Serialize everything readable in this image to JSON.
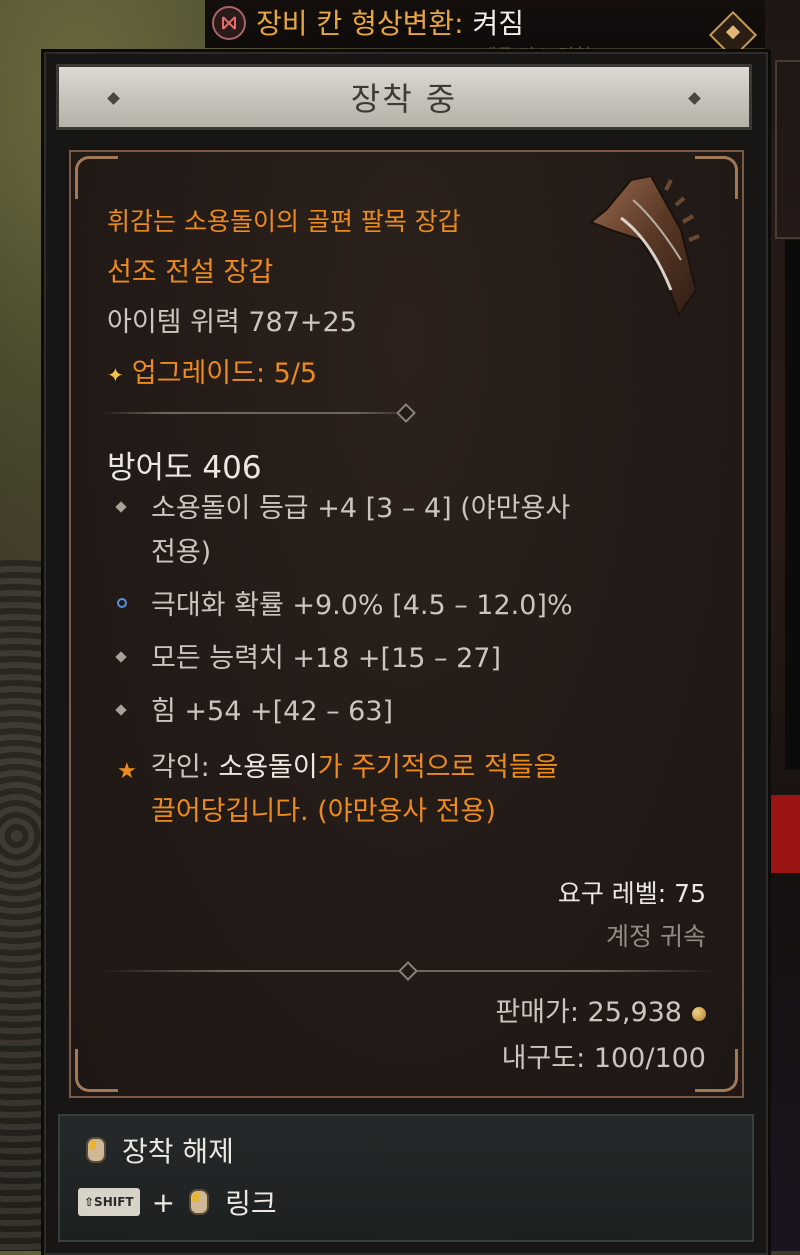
{
  "top_bar": {
    "label": "장비 칸 형상변환: ",
    "value": "켜짐",
    "sub_text": "세금 마스 경험"
  },
  "tooltip": {
    "header": "장착 중",
    "item": {
      "name": "휘감는 소용돌이의 골편 팔목 장갑",
      "type": "선조 전설 장갑",
      "power": "아이템 위력 787+25",
      "upgrade": "업그레이드: 5/5",
      "upgrade_icon": "✦",
      "armor": "방어도 406",
      "affixes": [
        {
          "text": "소용돌이 등급 +4 [3 – 4] (야만용사",
          "text2": "전용)",
          "icon": "diamond"
        },
        {
          "text": "극대화 확률 +9.0% [4.5 – 12.0]%",
          "icon": "ring-blue"
        },
        {
          "text": "모든 능력치 +18 +[15 – 27]",
          "icon": "diamond"
        },
        {
          "text": "힘 +54 +[42 – 63]",
          "icon": "diamond"
        }
      ],
      "aspect": {
        "prefix": "각인: ",
        "highlight": "소용돌이",
        "line1_rest": "가 주기적으로 적들을",
        "line2": "끌어당깁니다. (야만용사 전용)"
      },
      "required_level": "요구 레벨: 75",
      "account_bound": "계정 귀속",
      "sell_value": "판매가: 25,938",
      "durability": "내구도: 100/100"
    },
    "actions": {
      "unequip": "장착 해제",
      "shift_key": "⇧SHIFT",
      "plus": "+",
      "link": "링크"
    }
  },
  "colors": {
    "legendary": "#ec8a1e",
    "text": "#ebe8e2",
    "stat": "#cac6bd",
    "muted": "#908a80",
    "frame": "#7a5a44"
  }
}
